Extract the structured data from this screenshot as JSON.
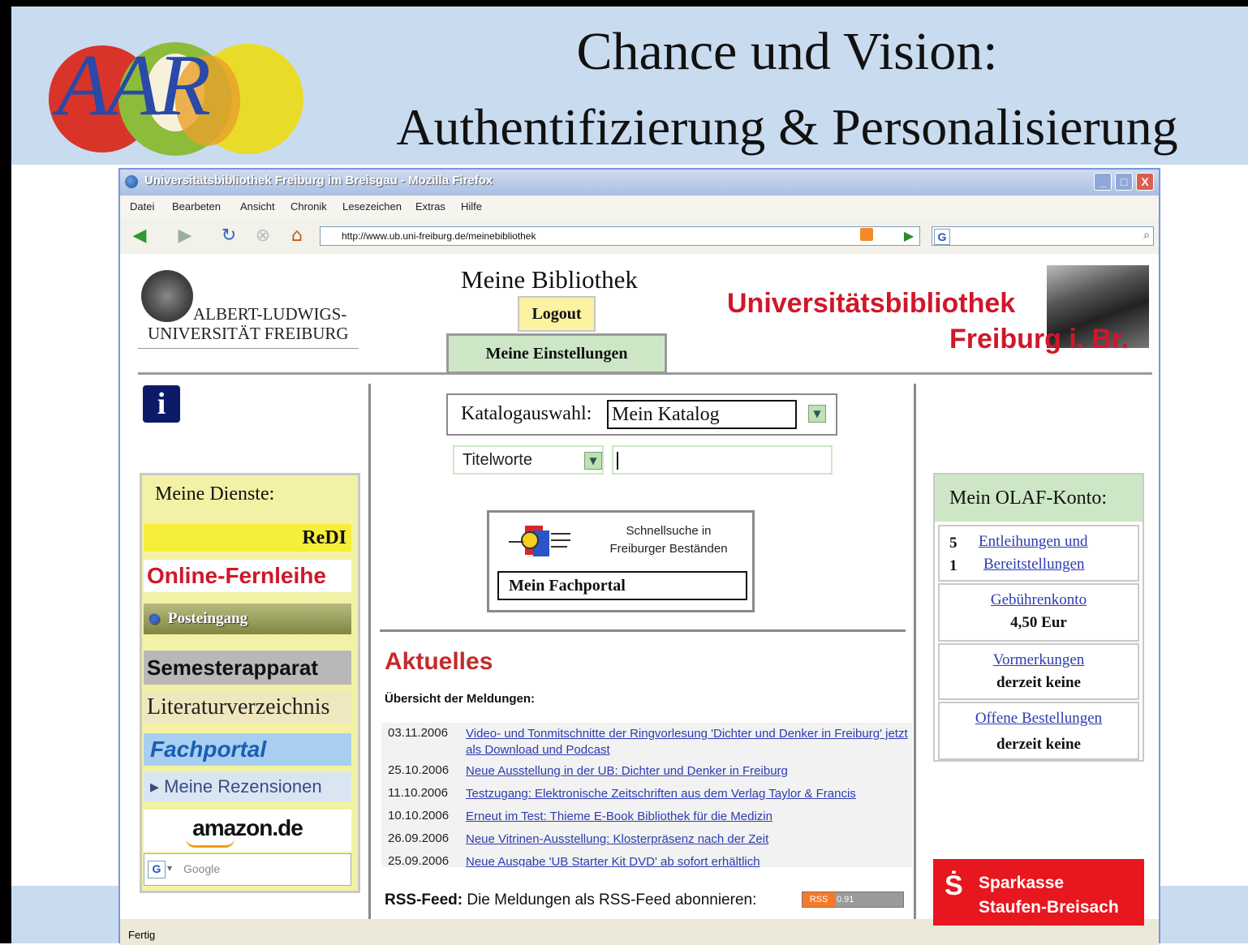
{
  "slide": {
    "logo_text": "AAR",
    "title_line1": "Chance und Vision:",
    "title_line2": "Authentifizierung & Personalisierung"
  },
  "browser": {
    "window_title": "Universitätsbibliothek Freiburg im Breisgau - Mozilla Firefox",
    "menu": [
      "Datei",
      "Bearbeten",
      "Ansicht",
      "Chronik",
      "Lesezeichen",
      "Extras",
      "Hilfe"
    ],
    "url": "http://www.ub.uni-freiburg.de/meinebibliothek",
    "status": "Fertig",
    "buttons": {
      "minimize": "_",
      "maximize": "□",
      "close": "X"
    }
  },
  "page": {
    "uni_name_line1": "ALBERT-LUDWIGS-",
    "uni_name_line2": "UNIVERSITÄT FREIBURG",
    "title": "Meine Bibliothek",
    "logout": "Logout",
    "settings": "Meine Einstellungen",
    "library_line1": "Universitätsbibliothek",
    "library_line2": "Freiburg i. Br.",
    "info_icon": "i",
    "services": {
      "heading": "Meine Dienste:",
      "items": [
        "ReDI",
        "Online-Fernleihe",
        "Posteingang",
        "Semesterapparat",
        "Literaturverzeichnis",
        "Fachportal",
        "▸ Meine Rezensionen",
        "amazon.de"
      ],
      "google_icon": "G",
      "google_placeholder": "Google"
    },
    "search": {
      "catalog_label": "Katalogauswahl:",
      "catalog_value": "Mein Katalog",
      "field_value": "Titelworte",
      "quick_search_line1": "Schnellsuche in",
      "quick_search_line2": "Freiburger Beständen",
      "fachportal_value": "Mein Fachportal"
    },
    "news": {
      "heading": "Aktuelles",
      "subheading": "Übersicht der Meldungen:",
      "items": [
        {
          "date": "03.11.2006",
          "text": "Video- und Tonmitschnitte der Ringvorlesung 'Dichter und Denker in Freiburg' jetzt als Download und Podcast"
        },
        {
          "date": "25.10.2006",
          "text": "Neue Ausstellung in der UB: Dichter und Denker in Freiburg"
        },
        {
          "date": "11.10.2006",
          "text": "Testzugang: Elektronische Zeitschriften aus dem Verlag Taylor & Francis"
        },
        {
          "date": "10.10.2006",
          "text": "Erneut im Test: Thieme E-Book Bibliothek für die Medizin"
        },
        {
          "date": "26.09.2006",
          "text": "Neue Vitrinen-Ausstellung: Klosterpräsenz nach der Zeit"
        },
        {
          "date": "25.09.2006",
          "text": "Neue Ausgabe 'UB Starter Kit DVD' ab sofort erhältlich"
        }
      ],
      "rss_label": "RSS-Feed:",
      "rss_text": "Die Meldungen als RSS-Feed abonnieren:",
      "rss_badge_left": "RSS",
      "rss_badge_right": "0.91"
    },
    "olaf": {
      "heading": "Mein OLAF-Konto:",
      "loans_count": "5",
      "loans_link": "Entleihungen und",
      "pickup_count": "1",
      "pickup_link": "Bereitstellungen",
      "fees_link": "Gebührenkonto",
      "fees_value": "4,50 Eur",
      "reservations_link": "Vormerkungen",
      "reservations_value": "derzeit keine",
      "orders_link": "Offene Bestellungen",
      "orders_value": "derzeit keine"
    },
    "sponsor": {
      "line1": "Sparkasse",
      "line2": "Staufen-Breisach"
    }
  }
}
